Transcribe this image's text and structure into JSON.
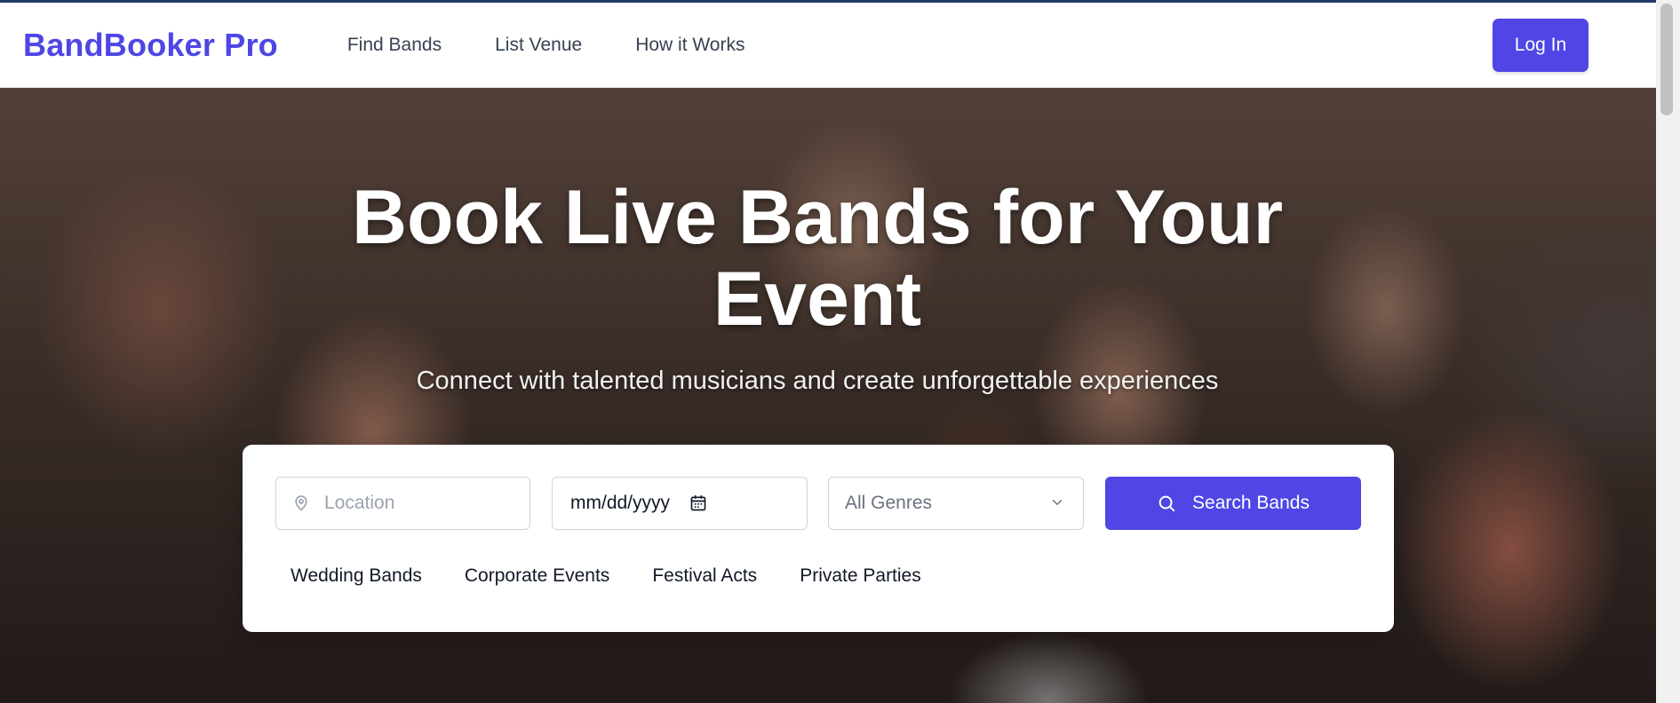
{
  "header": {
    "brand": "BandBooker Pro",
    "nav": [
      "Find Bands",
      "List Venue",
      "How it Works"
    ],
    "login_label": "Log In"
  },
  "hero": {
    "title": "Book Live Bands for Your Event",
    "subtitle": "Connect with talented musicians and create unforgettable experiences"
  },
  "search": {
    "location_placeholder": "Location",
    "date_value": "mm/dd/yyyy",
    "genre_selected": "All Genres",
    "button_label": "Search Bands",
    "categories": [
      "Wedding Bands",
      "Corporate Events",
      "Festival Acts",
      "Private Parties"
    ]
  },
  "colors": {
    "brand": "#4f46e5",
    "nav_text": "#374151"
  },
  "icons": [
    "map-pin-icon",
    "calendar-icon",
    "chevron-down-icon",
    "search-icon"
  ]
}
